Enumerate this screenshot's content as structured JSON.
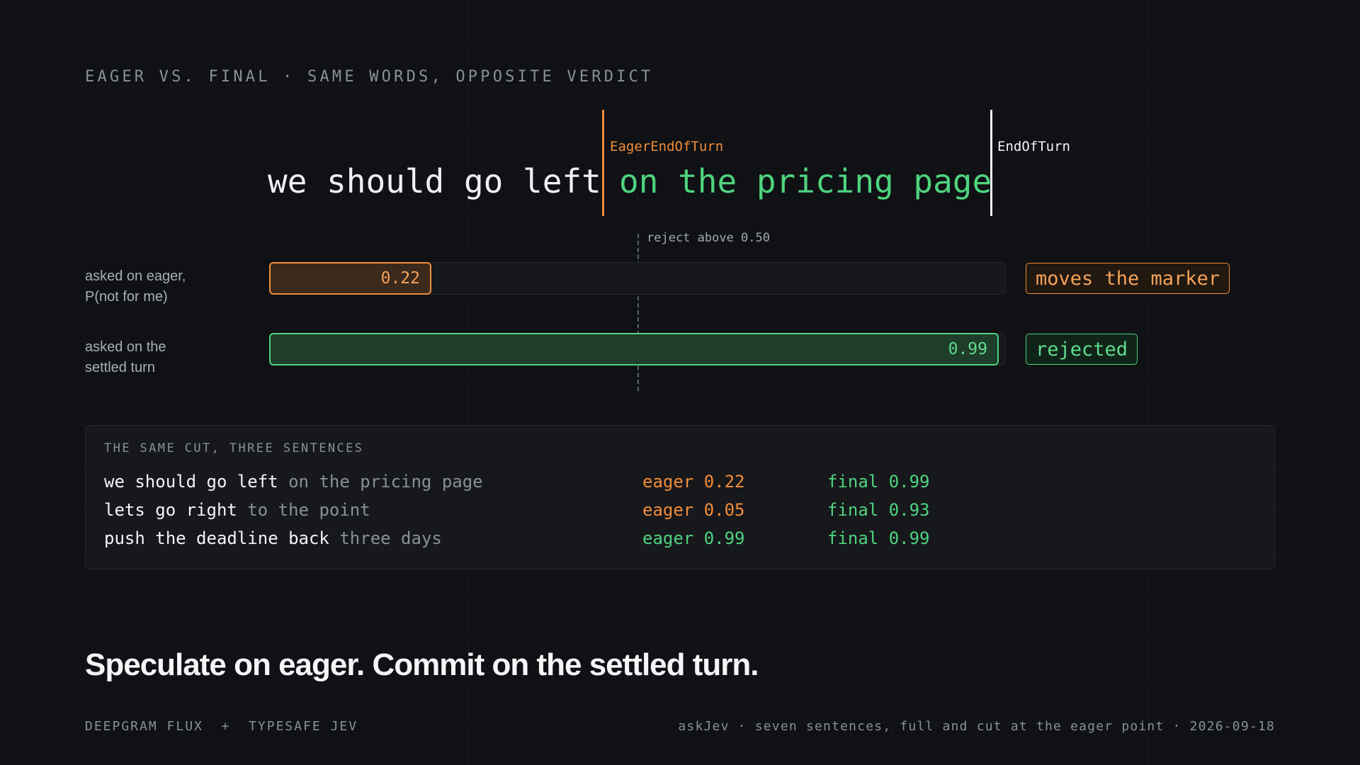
{
  "heading": "EAGER VS. FINAL · SAME WORDS, OPPOSITE VERDICT",
  "sentence": {
    "spoken": "we should go left",
    "rest": "on the pricing page"
  },
  "markers": {
    "eager": "EagerEndOfTurn",
    "final": "EndOfTurn"
  },
  "threshold": {
    "label": "reject above 0.50",
    "value": 0.5
  },
  "rows": [
    {
      "label_line1": "asked on eager,",
      "label_line2": "P(not for me)",
      "value": 0.22,
      "value_text": "0.22",
      "verdict": "moves the marker",
      "color": "#f28c38"
    },
    {
      "label_line1": "asked on the",
      "label_line2": "settled turn",
      "value": 0.99,
      "value_text": "0.99",
      "verdict": "rejected",
      "color": "#4fd37f"
    }
  ],
  "table": {
    "title": "THE SAME CUT, THREE SENTENCES",
    "rows": [
      {
        "said": "we should go left",
        "rest": "on the pricing page",
        "eager": "eager 0.22",
        "final": "final 0.99",
        "eager_color": "#f28c38"
      },
      {
        "said": "lets go right",
        "rest": "to the point",
        "eager": "eager 0.05",
        "final": "final 0.93",
        "eager_color": "#f28c38"
      },
      {
        "said": "push the deadline back",
        "rest": "three days",
        "eager": "eager 0.99",
        "final": "final 0.99",
        "eager_color": "#4fd37f"
      }
    ]
  },
  "tagline": "Speculate on eager. Commit on the settled turn.",
  "footer": {
    "left": "DEEPGRAM FLUX  +  TYPESAFE JEV",
    "right": "askJev · seven sentences, full and cut at the eager point · 2026-09-18"
  }
}
